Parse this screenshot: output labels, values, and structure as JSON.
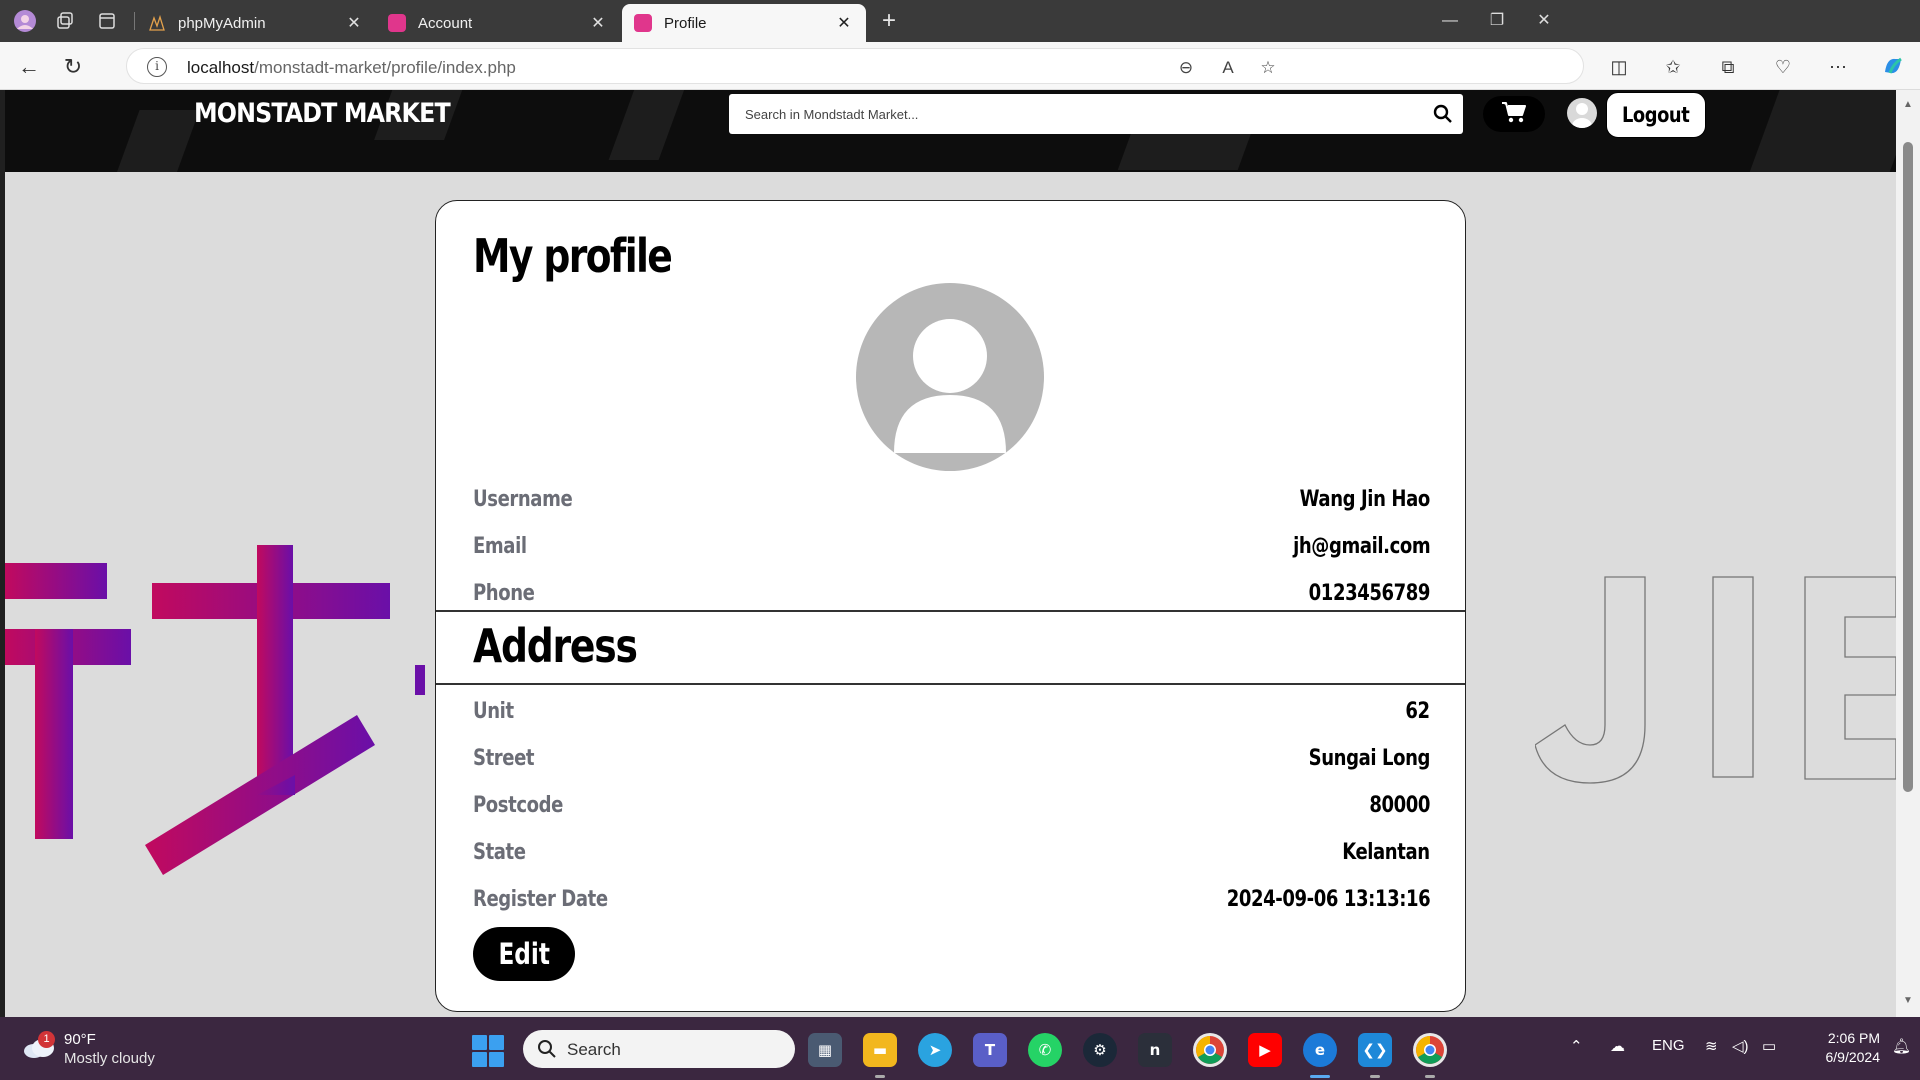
{
  "browser": {
    "tabs": [
      {
        "title": "phpMyAdmin",
        "icon": "phpmyadmin-icon"
      },
      {
        "title": "Account",
        "icon": "site-favicon"
      },
      {
        "title": "Profile",
        "icon": "site-favicon",
        "active": true
      }
    ],
    "url_host": "localhost",
    "url_path": "/monstadt-market/profile/index.php"
  },
  "site": {
    "logo": "MONSTADT MARKET",
    "search_placeholder": "Search in Mondstadt Market...",
    "logout_label": "Logout"
  },
  "profile": {
    "title": "My profile",
    "fields": [
      {
        "label": "Username",
        "value": "Wang Jin Hao"
      },
      {
        "label": "Email",
        "value": "jh@gmail.com"
      },
      {
        "label": "Phone",
        "value": "0123456789"
      }
    ],
    "address_title": "Address",
    "address_fields": [
      {
        "label": "Unit",
        "value": "62"
      },
      {
        "label": "Street",
        "value": "Sungai Long"
      },
      {
        "label": "Postcode",
        "value": "80000"
      },
      {
        "label": "State",
        "value": "Kelantan"
      },
      {
        "label": "Register Date",
        "value": "2024-09-06 13:13:16"
      }
    ],
    "edit_label": "Edit"
  },
  "decorations": {
    "left_text": "テオ",
    "right_text": "JIE"
  },
  "taskbar": {
    "weather_temp": "90°F",
    "weather_condition": "Mostly cloudy",
    "weather_badge": "1",
    "search_label": "Search",
    "language": "ENG",
    "time": "2:06 PM",
    "date": "6/9/2024"
  },
  "colors": {
    "header_bg": "#0d0d0d",
    "page_bg": "#dcdcdc",
    "label_gray": "#6b6d76",
    "taskbar_bg": "#3b2740"
  }
}
